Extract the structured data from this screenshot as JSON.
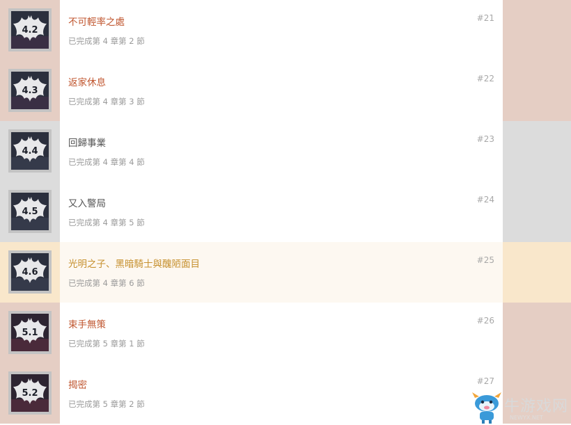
{
  "colors": {
    "title_rose": "#c0562f",
    "title_gray": "#555555",
    "title_gold": "#c6902e",
    "subtext": "#9a9a9a",
    "tint_rose": "#e5cec4",
    "tint_gray": "#dcdcdc",
    "tint_peach": "#f9e7cb"
  },
  "achievements": [
    {
      "badge": "4.2",
      "icon": "bat-emblem-icon",
      "title": "不可輕率之處",
      "status": "已完成第 4 章第 2 節",
      "number": "#21",
      "tint": "rose"
    },
    {
      "badge": "4.3",
      "icon": "bat-emblem-icon",
      "title": "返家休息",
      "status": "已完成第 4 章第 3 節",
      "number": "#22",
      "tint": "rose"
    },
    {
      "badge": "4.4",
      "icon": "bat-emblem-icon",
      "title": "回歸事業",
      "status": "已完成第 4 章第 4 節",
      "number": "#23",
      "tint": "gray"
    },
    {
      "badge": "4.5",
      "icon": "bat-emblem-icon",
      "title": "又入警局",
      "status": "已完成第 4 章第 5 節",
      "number": "#24",
      "tint": "gray"
    },
    {
      "badge": "4.6",
      "icon": "bat-emblem-icon",
      "title": "光明之子、黑暗騎士與醜陋面目",
      "status": "已完成第 4 章第 6 節",
      "number": "#25",
      "tint": "peach"
    },
    {
      "badge": "5.1",
      "icon": "bat-emblem-icon",
      "title": "束手無策",
      "status": "已完成第 5 章第 1 節",
      "number": "#26",
      "tint": "rose"
    },
    {
      "badge": "5.2",
      "icon": "bat-emblem-icon",
      "title": "揭密",
      "status": "已完成第 5 章第 2 節",
      "number": "#27",
      "tint": "rose"
    }
  ],
  "watermark": {
    "text": "牛游戏网",
    "url": "NEWYX.NET",
    "icon": "cow-mascot-icon"
  }
}
